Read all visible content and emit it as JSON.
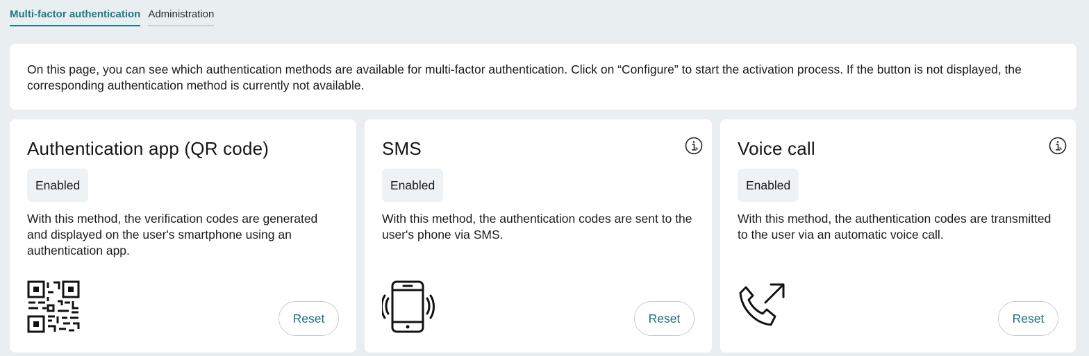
{
  "tabs": [
    {
      "label": "Multi-factor authentication",
      "active": true
    },
    {
      "label": "Administration",
      "active": false
    }
  ],
  "intro": "On this page, you can see which authentication methods are available for multi-factor authentication. Click on “Configure” to start the activation process. If the button is not displayed, the corresponding authentication method is currently not available.",
  "cards": [
    {
      "title": "Authentication app (QR code)",
      "status": "Enabled",
      "description": "With this method, the verification codes are generated and displayed on the user's smartphone using an authentication app.",
      "icon": "qr-code-icon",
      "has_info": false,
      "reset_label": "Reset"
    },
    {
      "title": "SMS",
      "status": "Enabled",
      "description": "With this method, the authentication codes are sent to the user's phone via SMS.",
      "icon": "vibrating-phone-icon",
      "has_info": true,
      "reset_label": "Reset"
    },
    {
      "title": "Voice call",
      "status": "Enabled",
      "description": "With this method, the authentication codes are transmitted to the user via an automatic voice call.",
      "icon": "outgoing-call-icon",
      "has_info": true,
      "reset_label": "Reset"
    }
  ],
  "colors": {
    "accent": "#1e7a84",
    "background": "#e9eef1",
    "badge": "#eef2f4"
  }
}
